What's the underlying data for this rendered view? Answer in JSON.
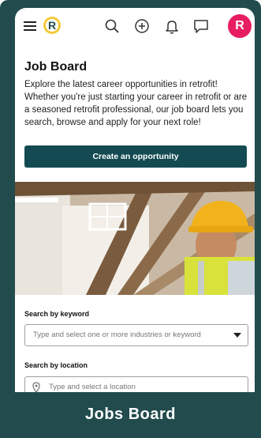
{
  "header": {
    "logo_letter": "R",
    "avatar_letter": "R",
    "avatar_color": "#e81e63",
    "logo_color": "#f4c93b",
    "icons": [
      "menu-icon",
      "search-icon",
      "add-circle-icon",
      "bell-icon",
      "chat-icon"
    ]
  },
  "page": {
    "title": "Job Board",
    "description": "Explore the latest career opportunities in retrofit! Whether you're just starting your career in retrofit or are a seasoned retrofit professional, our job board lets you search, browse and apply for your next role!",
    "create_button": "Create an opportunity"
  },
  "search": {
    "keyword_label": "Search by keyword",
    "keyword_placeholder": "Type and select one or more industries or keyword",
    "location_label": "Search by location",
    "location_placeholder": "Type and select a location"
  },
  "footer": {
    "title": "Jobs Board"
  },
  "colors": {
    "frame": "#214b4d",
    "button": "#144b53"
  }
}
